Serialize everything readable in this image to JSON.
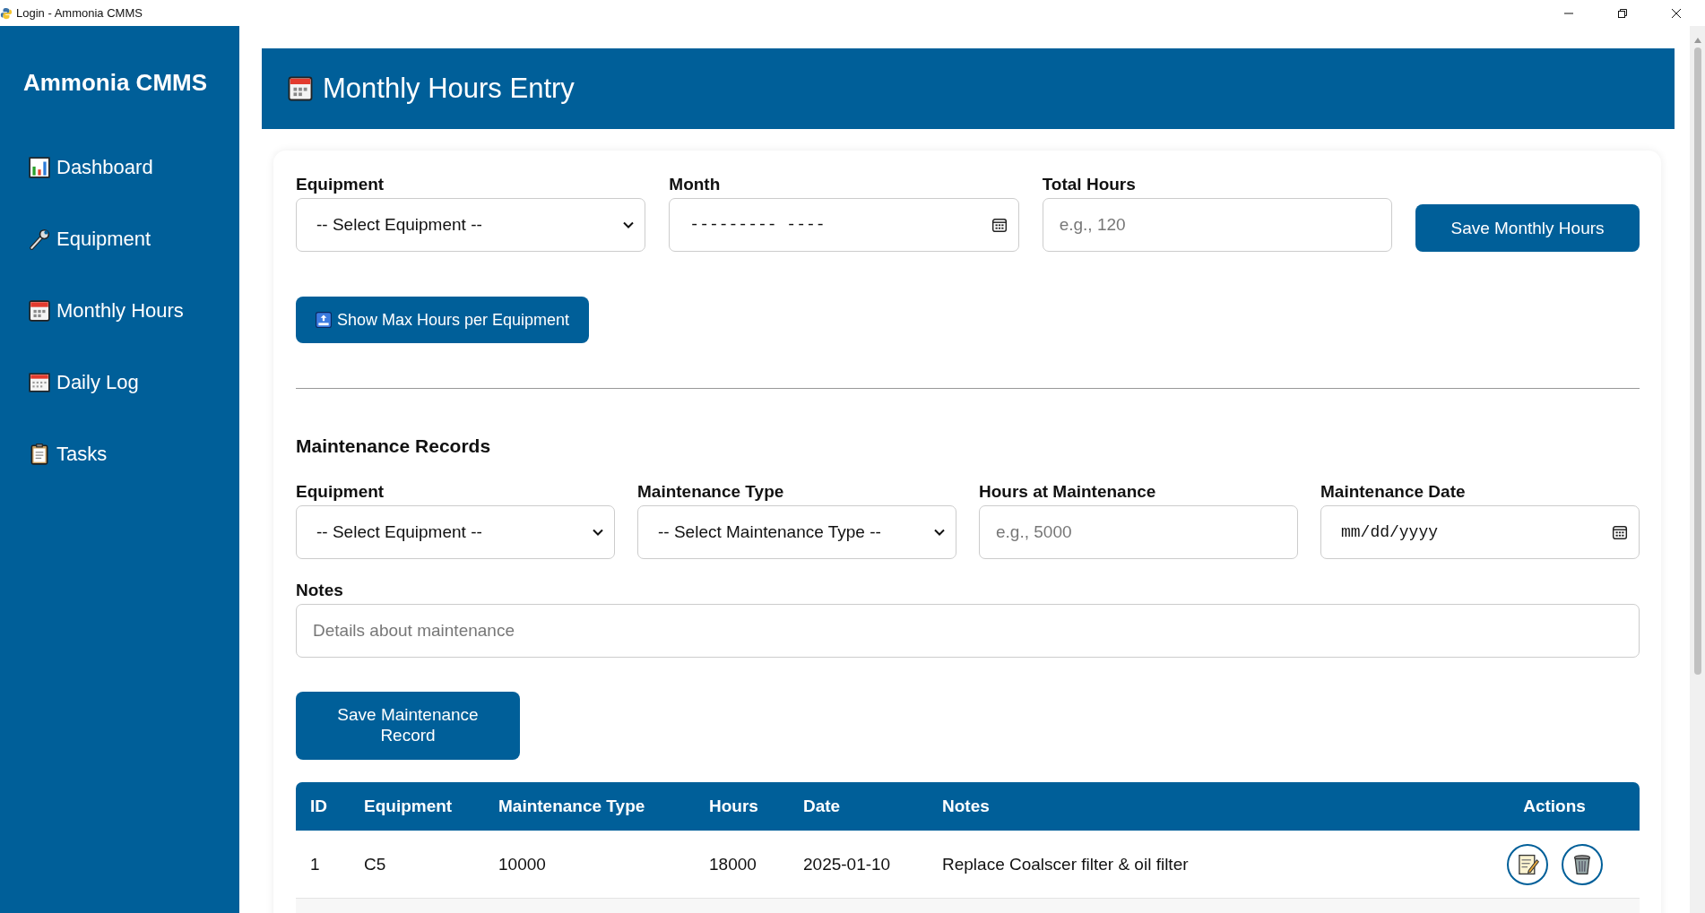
{
  "window": {
    "title": "Login - Ammonia CMMS"
  },
  "sidebar": {
    "title": "Ammonia CMMS",
    "items": [
      {
        "label": "Dashboard",
        "kind": "chart"
      },
      {
        "label": "Equipment",
        "kind": "wrench"
      },
      {
        "label": "Monthly Hours",
        "kind": "calendar"
      },
      {
        "label": "Daily Log",
        "kind": "planner"
      },
      {
        "label": "Tasks",
        "kind": "clipboard"
      }
    ]
  },
  "header": {
    "title": "Monthly Hours Entry"
  },
  "monthly_form": {
    "fields": [
      {
        "kind": "select",
        "label": "Equipment",
        "value": "-- Select Equipment --"
      },
      {
        "kind": "date",
        "label": "Month",
        "value": "--------- ----"
      },
      {
        "kind": "text",
        "label": "Total Hours",
        "placeholder": "e.g., 120"
      }
    ],
    "save_button": "Save Monthly Hours",
    "max_button": "Show Max Hours per Equipment"
  },
  "maintenance": {
    "title": "Maintenance Records",
    "fields": [
      {
        "kind": "select",
        "label": "Equipment",
        "value": "-- Select Equipment --"
      },
      {
        "kind": "select",
        "label": "Maintenance Type",
        "value": "-- Select Maintenance Type --"
      },
      {
        "kind": "text",
        "label": "Hours at Maintenance",
        "placeholder": "e.g., 5000"
      },
      {
        "kind": "date",
        "label": "Maintenance Date",
        "value": "mm/dd/yyyy"
      }
    ],
    "notes": {
      "label": "Notes",
      "placeholder": "Details about maintenance"
    },
    "save_button": "Save Maintenance Record"
  },
  "table": {
    "columns": [
      "ID",
      "Equipment",
      "Maintenance Type",
      "Hours",
      "Date",
      "Notes",
      "Actions"
    ],
    "rows": [
      {
        "cells": [
          "1",
          "C5",
          "10000",
          "18000",
          "2025-01-10",
          "Replace Coalscer filter & oil filter"
        ]
      }
    ]
  }
}
